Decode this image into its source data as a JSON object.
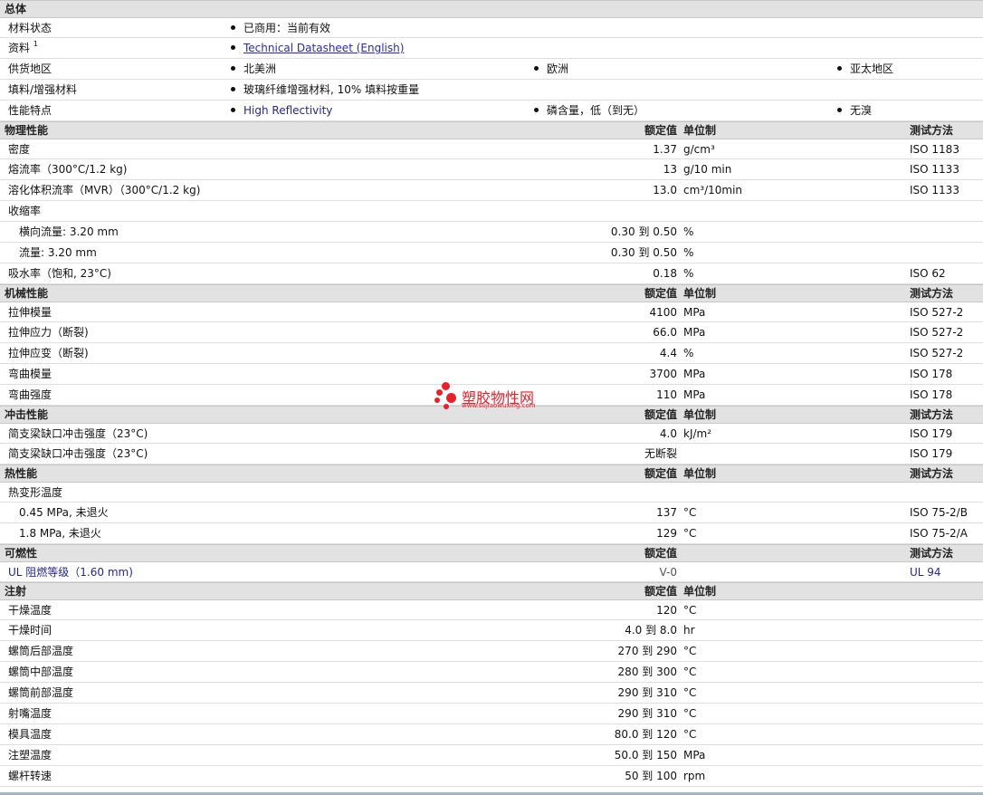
{
  "general": {
    "title": "总体",
    "status_label": "材料状态",
    "status_value": "已商用：当前有效",
    "info_label": "资料",
    "info_sup": "1",
    "info_link": "Technical Datasheet (English)",
    "region_label": "供货地区",
    "regions": [
      "北美洲",
      "欧洲",
      "亚太地区"
    ],
    "filler_label": "填料/增强材料",
    "filler_value": "玻璃纤维增强材料, 10% 填料按重量",
    "features_label": "性能特点",
    "features": [
      "High Reflectivity",
      "磷含量，低（到无）",
      "无溴"
    ]
  },
  "headers": {
    "value": "额定值",
    "unit": "单位制",
    "method": "测试方法"
  },
  "sections": {
    "physical": {
      "title": "物理性能",
      "rows": [
        {
          "label": "密度",
          "value": "1.37",
          "unit": "g/cm³",
          "method": "ISO 1183"
        },
        {
          "label": "熔流率（300°C/1.2 kg)",
          "value": "13",
          "unit": "g/10 min",
          "method": "ISO 1133"
        },
        {
          "label": "溶化体积流率（MVR）（300°C/1.2 kg)",
          "value": "13.0",
          "unit": "cm³/10min",
          "method": "ISO 1133"
        },
        {
          "label": "收缩率",
          "value": "",
          "unit": "",
          "method": ""
        },
        {
          "label": "横向流量: 3.20 mm",
          "value": "0.30 到  0.50",
          "unit": "%",
          "method": ""
        },
        {
          "label": "流量: 3.20 mm",
          "value": "0.30 到  0.50",
          "unit": "%",
          "method": ""
        },
        {
          "label": "吸水率（饱和, 23°C)",
          "value": "0.18",
          "unit": "%",
          "method": "ISO 62"
        }
      ]
    },
    "mechanical": {
      "title": "机械性能",
      "rows": [
        {
          "label": "拉伸模量",
          "value": "4100",
          "unit": "MPa",
          "method": "ISO 527-2"
        },
        {
          "label": "拉伸应力（断裂)",
          "value": "66.0",
          "unit": "MPa",
          "method": "ISO 527-2"
        },
        {
          "label": "拉伸应变（断裂)",
          "value": "4.4",
          "unit": "%",
          "method": "ISO 527-2"
        },
        {
          "label": "弯曲模量",
          "value": "3700",
          "unit": "MPa",
          "method": "ISO 178"
        },
        {
          "label": "弯曲强度",
          "value": "110",
          "unit": "MPa",
          "method": "ISO 178"
        }
      ]
    },
    "impact": {
      "title": "冲击性能",
      "rows": [
        {
          "label": "简支梁缺口冲击强度（23°C)",
          "value": "4.0",
          "unit": "kJ/m²",
          "method": "ISO 179"
        },
        {
          "label": "简支梁缺口冲击强度（23°C)",
          "value": "无断裂",
          "unit": "",
          "method": "ISO 179"
        }
      ]
    },
    "thermal": {
      "title": "热性能",
      "rows": [
        {
          "label": "热变形温度",
          "value": "",
          "unit": "",
          "method": ""
        },
        {
          "label": "0.45 MPa, 未退火",
          "value": "137",
          "unit": "°C",
          "method": "ISO 75-2/B"
        },
        {
          "label": "1.8 MPa, 未退火",
          "value": "129",
          "unit": "°C",
          "method": "ISO 75-2/A"
        }
      ]
    },
    "flammability": {
      "title": "可燃性",
      "rows": [
        {
          "label": "UL 阻燃等级（1.60 mm)",
          "value": "V-0",
          "unit": "",
          "method": "UL 94"
        }
      ]
    },
    "injection": {
      "title": "注射",
      "rows": [
        {
          "label": "干燥温度",
          "value": "120",
          "unit": "°C",
          "method": ""
        },
        {
          "label": "干燥时间",
          "value": "4.0 到  8.0",
          "unit": "hr",
          "method": ""
        },
        {
          "label": "螺筒后部温度",
          "value": "270 到  290",
          "unit": "°C",
          "method": ""
        },
        {
          "label": "螺筒中部温度",
          "value": "280 到  300",
          "unit": "°C",
          "method": ""
        },
        {
          "label": "螺筒前部温度",
          "value": "290 到  310",
          "unit": "°C",
          "method": ""
        },
        {
          "label": "射嘴温度",
          "value": "290 到  310",
          "unit": "°C",
          "method": ""
        },
        {
          "label": "模具温度",
          "value": "80.0 到  120",
          "unit": "°C",
          "method": ""
        },
        {
          "label": "注塑温度",
          "value": "50.0 到  150",
          "unit": "MPa",
          "method": ""
        },
        {
          "label": "螺杆转速",
          "value": "50 到  100",
          "unit": "rpm",
          "method": ""
        }
      ]
    }
  },
  "watermark": {
    "text": "塑胶物性网",
    "url": "www.sujiaowuxing.com"
  }
}
